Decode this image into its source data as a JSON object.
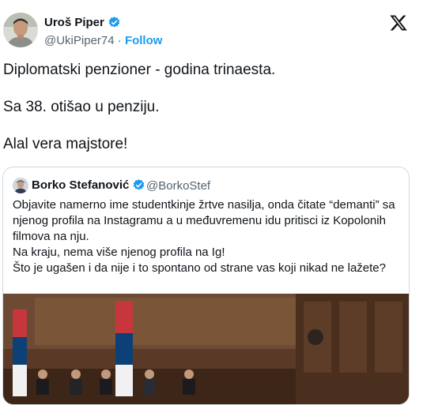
{
  "author": {
    "name": "Uroš Piper",
    "handle": "@UkiPiper74",
    "separator": "·",
    "follow_label": "Follow"
  },
  "tweet": {
    "lines": [
      "Diplomatski penzioner - godina trinaesta.",
      "Sa 38. otišao u penziju.",
      "Alal vera majstore!"
    ]
  },
  "quote": {
    "name": "Borko Stefanović",
    "handle": "@BorkoStef",
    "lines": [
      "Objavite namerno ime studentkinje žrtve nasilja, onda čitate “demanti” sa",
      "njenog profila na Instagramu a u međuvremenu idu pritisci iz Kopolonih",
      "filmova na nju.",
      "Na kraju, nema više njenog profila na Ig!",
      "Što je ugašen i da nije i to spontano od strane vas koji nikad ne lažete?"
    ]
  },
  "icons": {
    "verified": "verified-badge-icon",
    "brand": "x-logo-icon"
  },
  "colors": {
    "accent": "#1d9bf0",
    "text": "#0f1419",
    "muted": "#536471",
    "border": "#cfd9de"
  }
}
